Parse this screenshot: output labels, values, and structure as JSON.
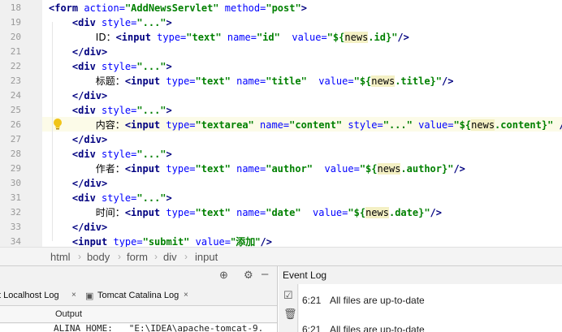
{
  "editor": {
    "line_numbers": [
      "18",
      "19",
      "20",
      "21",
      "22",
      "23",
      "24",
      "25",
      "26",
      "27",
      "28",
      "29",
      "30",
      "31",
      "32",
      "33",
      "34"
    ],
    "lines": [
      [
        {
          "t": "<form ",
          "c": "tg"
        },
        {
          "t": "action=",
          "c": "at"
        },
        {
          "t": "\"AddNewsServlet\" ",
          "c": "sv"
        },
        {
          "t": "method=",
          "c": "at"
        },
        {
          "t": "\"post\"",
          "c": "sv"
        },
        {
          "t": ">",
          "c": "tg"
        }
      ],
      [
        {
          "t": "    "
        },
        {
          "t": "<div ",
          "c": "tg"
        },
        {
          "t": "style=",
          "c": "at"
        },
        {
          "t": "\"...\"",
          "c": "sv"
        },
        {
          "t": ">",
          "c": "tg"
        }
      ],
      [
        {
          "t": "        "
        },
        {
          "t": "ID：",
          "c": "tx"
        },
        {
          "t": "<input ",
          "c": "tg"
        },
        {
          "t": "type=",
          "c": "at"
        },
        {
          "t": "\"text\" ",
          "c": "sv"
        },
        {
          "t": "name=",
          "c": "at"
        },
        {
          "t": "\"id\"  ",
          "c": "sv"
        },
        {
          "t": "value=",
          "c": "at"
        },
        {
          "t": "\"${",
          "c": "sv"
        },
        {
          "t": "news",
          "c": "hl"
        },
        {
          "t": ".id}\"",
          "c": "sv"
        },
        {
          "t": "/>",
          "c": "tg"
        }
      ],
      [
        {
          "t": "    "
        },
        {
          "t": "</div>",
          "c": "tg"
        }
      ],
      [
        {
          "t": "    "
        },
        {
          "t": "<div ",
          "c": "tg"
        },
        {
          "t": "style=",
          "c": "at"
        },
        {
          "t": "\"...\"",
          "c": "sv"
        },
        {
          "t": ">",
          "c": "tg"
        }
      ],
      [
        {
          "t": "        "
        },
        {
          "t": "标题：",
          "c": "tx"
        },
        {
          "t": "<input ",
          "c": "tg"
        },
        {
          "t": "type=",
          "c": "at"
        },
        {
          "t": "\"text\" ",
          "c": "sv"
        },
        {
          "t": "name=",
          "c": "at"
        },
        {
          "t": "\"title\"  ",
          "c": "sv"
        },
        {
          "t": "value=",
          "c": "at"
        },
        {
          "t": "\"${",
          "c": "sv"
        },
        {
          "t": "news",
          "c": "hl"
        },
        {
          "t": ".title}\"",
          "c": "sv"
        },
        {
          "t": "/>",
          "c": "tg"
        }
      ],
      [
        {
          "t": "    "
        },
        {
          "t": "</div>",
          "c": "tg"
        }
      ],
      [
        {
          "t": "    "
        },
        {
          "t": "<div ",
          "c": "tg"
        },
        {
          "t": "style=",
          "c": "at"
        },
        {
          "t": "\"...\"",
          "c": "sv"
        },
        {
          "t": ">",
          "c": "tg"
        }
      ],
      [
        {
          "t": "        "
        },
        {
          "t": "内容：",
          "c": "tx"
        },
        {
          "t": "<input ",
          "c": "tg"
        },
        {
          "t": "type=",
          "c": "at"
        },
        {
          "t": "\"textarea\" ",
          "c": "sv"
        },
        {
          "t": "name=",
          "c": "at"
        },
        {
          "t": "\"content\" ",
          "c": "sv"
        },
        {
          "t": "style=",
          "c": "at"
        },
        {
          "t": "\"...\" ",
          "c": "sv"
        },
        {
          "t": "value=",
          "c": "at"
        },
        {
          "t": "\"${",
          "c": "sv"
        },
        {
          "t": "news",
          "c": "hl"
        },
        {
          "t": ".content}\" ",
          "c": "sv"
        },
        {
          "t": "/>",
          "c": "tg"
        }
      ],
      [
        {
          "t": "    "
        },
        {
          "t": "</div>",
          "c": "tg"
        }
      ],
      [
        {
          "t": "    "
        },
        {
          "t": "<div ",
          "c": "tg"
        },
        {
          "t": "style=",
          "c": "at"
        },
        {
          "t": "\"...\"",
          "c": "sv"
        },
        {
          "t": ">",
          "c": "tg"
        }
      ],
      [
        {
          "t": "        "
        },
        {
          "t": "作者：",
          "c": "tx"
        },
        {
          "t": "<input ",
          "c": "tg"
        },
        {
          "t": "type=",
          "c": "at"
        },
        {
          "t": "\"text\" ",
          "c": "sv"
        },
        {
          "t": "name=",
          "c": "at"
        },
        {
          "t": "\"author\"  ",
          "c": "sv"
        },
        {
          "t": "value=",
          "c": "at"
        },
        {
          "t": "\"${",
          "c": "sv"
        },
        {
          "t": "news",
          "c": "hl"
        },
        {
          "t": ".author}\"",
          "c": "sv"
        },
        {
          "t": "/>",
          "c": "tg"
        }
      ],
      [
        {
          "t": "    "
        },
        {
          "t": "</div>",
          "c": "tg"
        }
      ],
      [
        {
          "t": "    "
        },
        {
          "t": "<div ",
          "c": "tg"
        },
        {
          "t": "style=",
          "c": "at"
        },
        {
          "t": "\"...\"",
          "c": "sv"
        },
        {
          "t": ">",
          "c": "tg"
        }
      ],
      [
        {
          "t": "        "
        },
        {
          "t": "时间：",
          "c": "tx"
        },
        {
          "t": "<input ",
          "c": "tg"
        },
        {
          "t": "type=",
          "c": "at"
        },
        {
          "t": "\"text\" ",
          "c": "sv"
        },
        {
          "t": "name=",
          "c": "at"
        },
        {
          "t": "\"date\"  ",
          "c": "sv"
        },
        {
          "t": "value=",
          "c": "at"
        },
        {
          "t": "\"${",
          "c": "sv"
        },
        {
          "t": "news",
          "c": "hl"
        },
        {
          "t": ".date}\"",
          "c": "sv"
        },
        {
          "t": "/>",
          "c": "tg"
        }
      ],
      [
        {
          "t": "    "
        },
        {
          "t": "</div>",
          "c": "tg"
        }
      ],
      [
        {
          "t": "    "
        },
        {
          "t": "<input ",
          "c": "tg"
        },
        {
          "t": "type=",
          "c": "at"
        },
        {
          "t": "\"submit\" ",
          "c": "sv"
        },
        {
          "t": "value=",
          "c": "at"
        },
        {
          "t": "\"添加\"",
          "c": "sv"
        },
        {
          "t": "/>",
          "c": "tg"
        }
      ]
    ]
  },
  "breadcrumb": [
    "html",
    "body",
    "form",
    "div",
    "input"
  ],
  "tabs": {
    "localhost_log": "t Localhost Log",
    "catalina_log": "Tomcat Catalina Log"
  },
  "output": {
    "label": "Output",
    "first_line": "ALINA_HOME:   \"E:\\IDEA\\apache-tomcat-9."
  },
  "event_log": {
    "title": "Event Log",
    "entries": [
      {
        "time": "6:21",
        "message": "All files are up-to-date"
      },
      {
        "time": "6:21",
        "message": "All files are up-to-date"
      }
    ]
  },
  "colors": {
    "tag": "#000080",
    "attribute": "#0000ff",
    "string": "#008000",
    "highlight": "#f4f0c4"
  }
}
